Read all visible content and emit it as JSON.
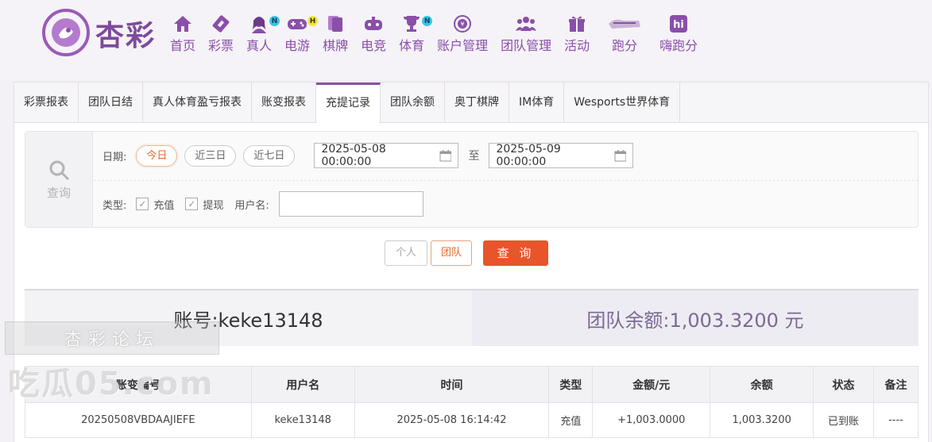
{
  "brand": {
    "logo_text": "杏彩"
  },
  "nav": [
    {
      "label": "首页",
      "icon": "home-icon",
      "badge": ""
    },
    {
      "label": "彩票",
      "icon": "ticket-icon",
      "badge": ""
    },
    {
      "label": "真人",
      "icon": "live-dealer-icon",
      "badge": "N"
    },
    {
      "label": "电游",
      "icon": "gamepad-icon",
      "badge": "H"
    },
    {
      "label": "棋牌",
      "icon": "cards-icon",
      "badge": ""
    },
    {
      "label": "电竞",
      "icon": "esports-icon",
      "badge": ""
    },
    {
      "label": "体育",
      "icon": "trophy-icon",
      "badge": "N"
    },
    {
      "label": "账户管理",
      "icon": "account-icon",
      "badge": ""
    },
    {
      "label": "团队管理",
      "icon": "team-icon",
      "badge": ""
    },
    {
      "label": "活动",
      "icon": "gift-icon",
      "badge": ""
    },
    {
      "label": "跑分",
      "icon": "running-icon",
      "badge": ""
    },
    {
      "label": "嗨跑分",
      "icon": "hi-icon",
      "badge": ""
    }
  ],
  "tabs": [
    "彩票报表",
    "团队日结",
    "真人体育盈亏报表",
    "账变报表",
    "充提记录",
    "团队余额",
    "奥丁棋牌",
    "IM体育",
    "Wesports世界体育"
  ],
  "active_tab": "充提记录",
  "filter": {
    "query_label": "查询",
    "date_label": "日期:",
    "quick_dates": [
      "今日",
      "近三日",
      "近七日"
    ],
    "start_date": "2025-05-08 00:00:00",
    "to_label": "至",
    "end_date": "2025-05-09 00:00:00",
    "type_label": "类型:",
    "type_options": [
      "充值",
      "提现"
    ],
    "username_label": "用户名:",
    "username_value": ""
  },
  "buttons": {
    "personal": "个人",
    "team": "团队",
    "query": "查 询"
  },
  "summary": {
    "account": "账号:keke13148",
    "team_balance": "团队余额:1,003.3200 元"
  },
  "table": {
    "headers": [
      "账变编号",
      "用户名",
      "时间",
      "类型",
      "金额/元",
      "余额",
      "状态",
      "备注"
    ],
    "rows": [
      [
        "20250508VBDAAJIEFE",
        "keke13148",
        "2025-05-08 16:14:42",
        "充值",
        "+1,003.0000",
        "1,003.3200",
        "已到账",
        "----"
      ]
    ]
  },
  "watermark": {
    "top": "杏彩论坛",
    "bottom": "吃瓜05.com"
  },
  "colors": {
    "brand_purple": "#8a4fa8",
    "accent_orange": "#e8552a",
    "positive_green": "#4a9b2f"
  }
}
